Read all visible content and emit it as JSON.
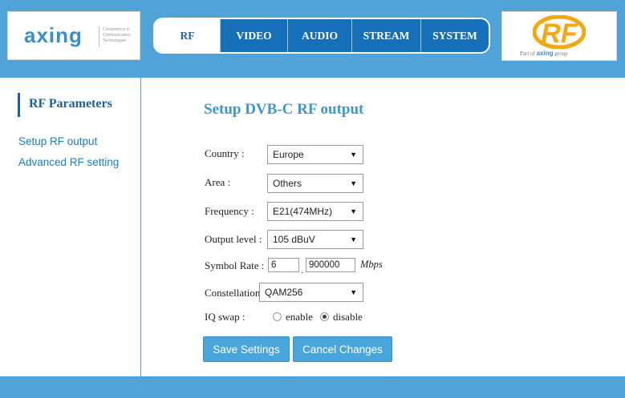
{
  "header": {
    "left_logo": {
      "wordmark": "axing",
      "tagline": "Competence in Communication Technologies"
    },
    "nav_tabs": [
      {
        "label": "RF",
        "active": true
      },
      {
        "label": "VIDEO",
        "active": false
      },
      {
        "label": "AUDIO",
        "active": false
      },
      {
        "label": "STREAM",
        "active": false
      },
      {
        "label": "SYSTEM",
        "active": false
      }
    ],
    "right_logo": {
      "mark": "RF",
      "tagline_prefix": "Part of",
      "tagline_brand": "axing",
      "tagline_suffix": "group"
    }
  },
  "sidebar": {
    "title": "RF Parameters",
    "links": [
      "Setup RF output",
      "Advanced RF setting"
    ]
  },
  "main": {
    "title": "Setup DVB-C RF output",
    "fields": {
      "country": {
        "label": "Country :",
        "value": "Europe"
      },
      "area": {
        "label": "Area :",
        "value": "Others"
      },
      "frequency": {
        "label": "Frequency :",
        "value": "E21(474MHz)"
      },
      "output_level": {
        "label": "Output level :",
        "value": "105 dBuV"
      },
      "symbol_rate": {
        "label": "Symbol Rate :",
        "integer": "6",
        "separator": ".",
        "fraction": "900000",
        "unit": "Mbps"
      },
      "constellation": {
        "label": "Constellation :",
        "value": "QAM256"
      },
      "iq_swap": {
        "label": "IQ swap :",
        "options": [
          "enable",
          "disable"
        ],
        "selected": "disable"
      }
    },
    "buttons": {
      "save": "Save Settings",
      "cancel": "Cancel Changes"
    }
  },
  "colors": {
    "bar_blue": "#4fa3d9",
    "nav_blue": "#1570b9",
    "title_blue": "#3d97d3",
    "button_blue": "#48a6dc",
    "rf_logo_orange": "#f3a812"
  }
}
